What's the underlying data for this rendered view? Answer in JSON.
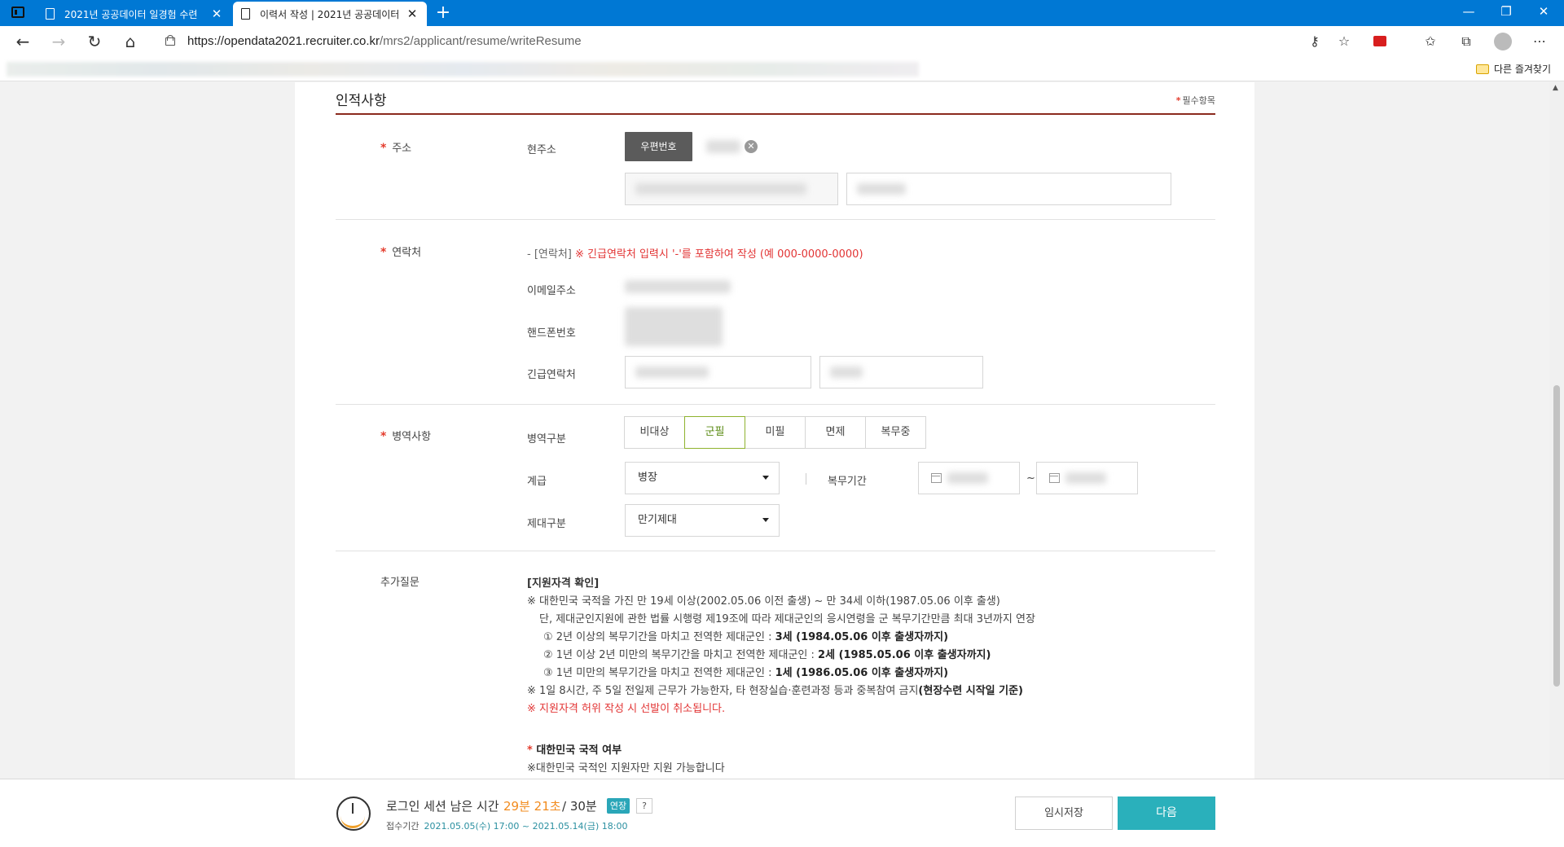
{
  "browser": {
    "tabs": [
      {
        "label": "2021년 공공데이터 일경험 수련"
      },
      {
        "label": "이력서 작성 | 2021년 공공데이터"
      }
    ],
    "url_host": "https://opendata2021.recruiter.co.kr",
    "url_path": "/mrs2/applicant/resume/writeResume",
    "favorites_other": "다른 즐겨찾기"
  },
  "section": {
    "title": "인적사항",
    "required_note": "필수항목"
  },
  "address": {
    "label": "주소",
    "current_label": "현주소",
    "zip_button": "우편번호"
  },
  "contact": {
    "label": "연락처",
    "notice_prefix": "- [연락처]",
    "notice": "※ 긴급연락처 입력시 '-'를 포함하여 작성 (예 000-0000-0000)",
    "email_label": "이메일주소",
    "phone_label": "핸드폰번호",
    "emergency_label": "긴급연락처"
  },
  "military": {
    "label": "병역사항",
    "type_label": "병역구분",
    "options": [
      "비대상",
      "군필",
      "미필",
      "면제",
      "복무중"
    ],
    "selected": "군필",
    "rank_label": "계급",
    "rank_value": "병장",
    "period_label": "복무기간",
    "period_sep": "~",
    "discharge_label": "제대구분",
    "discharge_value": "만기제대"
  },
  "questions": {
    "label": "추가질문",
    "heading": "[지원자격 확인]",
    "line1": "※ 대한민국 국적을 가진 만 19세 이상(2002.05.06 이전 출생) ~ 만 34세 이하(1987.05.06 이후 출생)",
    "line2": "단, 제대군인지원에 관한 법률 시행령 제19조에 따라 제대군인의 응시연령을 군 복무기간만큼 최대 3년까지 연장",
    "line3_text": "① 2년 이상의 복무기간을 마치고 전역한 제대군인 : ",
    "line3_bold": "3세 (1984.05.06 이후 출생자까지)",
    "line4_text": "② 1년 이상 2년 미만의 복무기간을 마치고 전역한 제대군인 : ",
    "line4_bold": "2세 (1985.05.06 이후 출생자까지)",
    "line5_text": "③ 1년 미만의 복무기간을 마치고 전역한 제대군인 : ",
    "line5_bold": "1세 (1986.05.06 이후 출생자까지)",
    "line6_text": "※ 1일 8시간, 주 5일 전일제 근무가 가능한자, 타 현장실습·훈련과정 등과 중복참여 금지",
    "line6_bold": "(현장수련 시작일 기준)",
    "line7": "※ 지원자격 허위 작성 시 선발이 취소됩니다.",
    "nationality_title": "대한민국 국적 여부",
    "nationality_desc": "※대한민국 국적인 지원자만 지원 가능합니다"
  },
  "bottom": {
    "session_label": "로그인 세션 남은 시간",
    "session_remaining": "29분 21초",
    "session_total": "/ 30분",
    "extend": "연장",
    "help": "?",
    "period_label": "접수기간",
    "period_dates": "2021.05.05(수) 17:00 ~ 2021.05.14(금) 18:00",
    "save_button": "임시저장",
    "next_button": "다음"
  },
  "colors": {
    "accent": "#2ab0bb",
    "required": "#e43c2d",
    "section_rule": "#8b2a1e",
    "selected_seg": "#8fb22e",
    "titlebar": "#0078d4"
  }
}
